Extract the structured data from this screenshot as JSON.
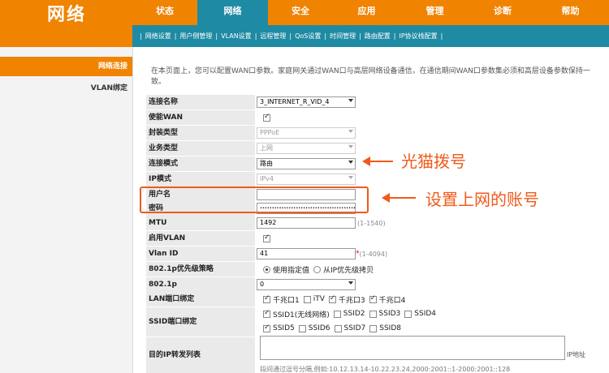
{
  "logo_text": "网络",
  "nav": {
    "tabs": [
      "状态",
      "网络",
      "安全",
      "应用",
      "管理",
      "诊断",
      "帮助"
    ],
    "active": "网络"
  },
  "subnav": [
    "网络设置",
    "用户侧管理",
    "VLAN设置",
    "远程管理",
    "QoS设置",
    "时间管理",
    "路由配置",
    "IP协议栈配置"
  ],
  "left_menu": {
    "active": "网络连接",
    "items": [
      "VLAN绑定"
    ]
  },
  "intro": "在本页面上，您可以配置WAN口参数。家庭网关通过WAN口与高层网络设备通信，在通信期间WAN口参数集必须和高层设备参数保持一致。",
  "form": {
    "conn_name_label": "连接名称",
    "conn_name_value": "3_INTERNET_R_VID_4",
    "enable_wan_label": "使能WAN",
    "encap_label": "封装类型",
    "encap_value": "PPPoE",
    "service_label": "业务类型",
    "service_value": "上网",
    "mode_label": "连接模式",
    "mode_value": "路由",
    "ip_mode_label": "IP模式",
    "ip_mode_value": "IPv4",
    "username_label": "用户名",
    "username_value": "",
    "password_label": "密码",
    "password_value": "••••••••••••••••••••••••••••••••••••••••••••",
    "mtu_label": "MTU",
    "mtu_value": "1492",
    "mtu_hint": "(1-1540)",
    "enable_vlan_label": "启用VLAN",
    "vlan_id_label": "Vlan ID",
    "vlan_id_value": "41",
    "vlan_required": "*",
    "vlan_hint": "(1-4094)",
    "prio_policy_label": "802.1p优先级策略",
    "prio_policy_opt1": "使用指定值",
    "prio_policy_opt2": "从IP优先级拷贝",
    "prio_label": "802.1p",
    "prio_value": "0",
    "lan_bind_label": "LAN端口绑定",
    "lan_ports": [
      {
        "label": "千兆口1",
        "checked": true
      },
      {
        "label": "iTV",
        "checked": false
      },
      {
        "label": "千兆口3",
        "checked": true
      },
      {
        "label": "千兆口4",
        "checked": true
      }
    ],
    "ssid_bind_label": "SSID端口绑定",
    "ssid_row1": [
      {
        "label": "SSID1(无线网络)",
        "checked": true
      },
      {
        "label": "SSID2",
        "checked": false
      },
      {
        "label": "SSID3",
        "checked": false
      },
      {
        "label": "SSID4",
        "checked": false
      }
    ],
    "ssid_row2": [
      {
        "label": "SSID5",
        "checked": true
      },
      {
        "label": "SSID6",
        "checked": false
      },
      {
        "label": "SSID7",
        "checked": false
      },
      {
        "label": "SSID8",
        "checked": false
      }
    ],
    "dest_ip_label": "目的IP转发列表",
    "ip_addr_hint": "IP地址",
    "bottom_note": "段间通过逗号分隔,例如:10.12.13.14-10.22.23.24,2000:2001::1-2000:2001::128"
  },
  "annotations": {
    "dial": "光猫拨号",
    "account": "设置上网的账号"
  },
  "colors": {
    "orange": "#f08300",
    "teal": "#1f8aa3",
    "annotation": "#f05a1a"
  }
}
